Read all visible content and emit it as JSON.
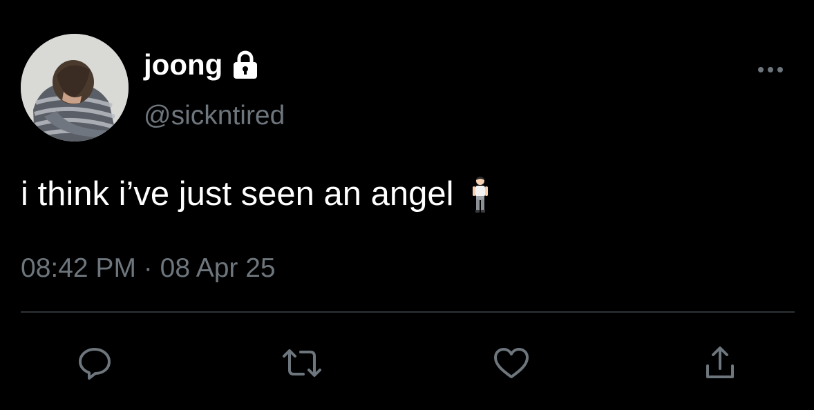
{
  "user": {
    "display_name": "joong",
    "handle": "@sickntired",
    "protected_icon": "lock-icon",
    "avatar": "avatar"
  },
  "tweet": {
    "text": "i think i’ve just seen an angel",
    "emoji": "person-standing-emoji"
  },
  "meta": {
    "time": "08:42 PM",
    "separator": "·",
    "date": "08 Apr 25"
  },
  "actions": [
    {
      "icon": "reply-icon"
    },
    {
      "icon": "retweet-icon"
    },
    {
      "icon": "like-icon"
    },
    {
      "icon": "share-icon"
    }
  ],
  "menu": {
    "icon": "more-icon"
  },
  "colors": {
    "background": "#000000",
    "primary_text": "#ffffff",
    "secondary_text": "#6e767d",
    "divider": "#2f3336"
  }
}
